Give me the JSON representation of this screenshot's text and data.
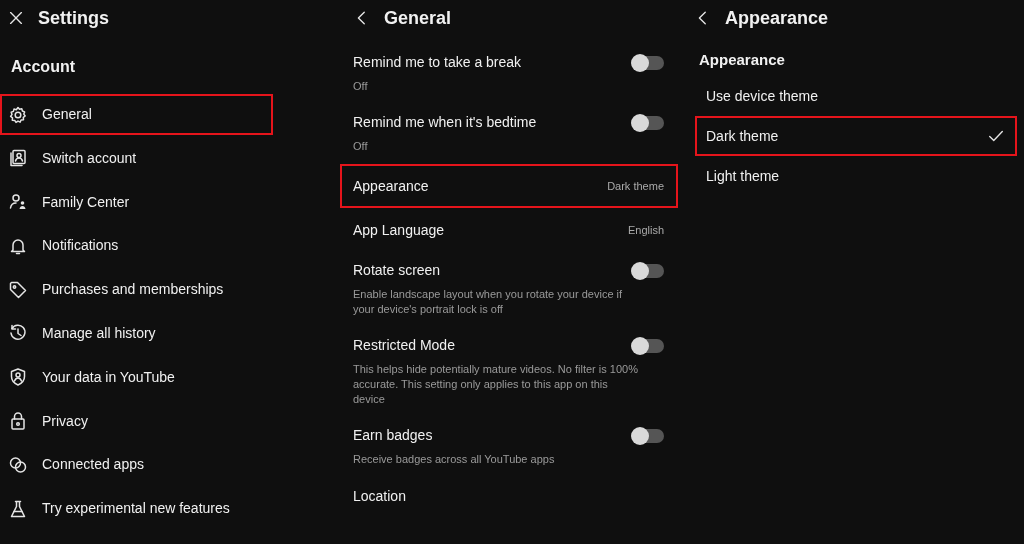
{
  "settings_panel": {
    "title": "Settings",
    "section": "Account",
    "items": [
      {
        "label": "General",
        "highlighted": true
      },
      {
        "label": "Switch account",
        "highlighted": false
      },
      {
        "label": "Family Center",
        "highlighted": false
      },
      {
        "label": "Notifications",
        "highlighted": false
      },
      {
        "label": "Purchases and memberships",
        "highlighted": false
      },
      {
        "label": "Manage all history",
        "highlighted": false
      },
      {
        "label": "Your data in YouTube",
        "highlighted": false
      },
      {
        "label": "Privacy",
        "highlighted": false
      },
      {
        "label": "Connected apps",
        "highlighted": false
      },
      {
        "label": "Try experimental new features",
        "highlighted": false
      }
    ]
  },
  "general_panel": {
    "title": "General",
    "rows": [
      {
        "kind": "toggle",
        "label": "Remind me to take a break",
        "description": "Off",
        "on": false,
        "highlighted": false
      },
      {
        "kind": "toggle",
        "label": "Remind me when it's bedtime",
        "description": "Off",
        "on": false,
        "highlighted": false
      },
      {
        "kind": "value",
        "label": "Appearance",
        "value": "Dark theme",
        "highlighted": true
      },
      {
        "kind": "value",
        "label": "App Language",
        "value": "English",
        "highlighted": false
      },
      {
        "kind": "toggle",
        "label": "Rotate screen",
        "description": "Enable landscape layout when you rotate your device if your device's portrait lock is off",
        "on": false,
        "highlighted": false
      },
      {
        "kind": "toggle",
        "label": "Restricted Mode",
        "description": "This helps hide potentially mature videos. No filter is 100% accurate. This setting only applies to this app on this device",
        "on": false,
        "highlighted": false
      },
      {
        "kind": "toggle",
        "label": "Earn badges",
        "description": "Receive badges across all YouTube apps",
        "on": false,
        "highlighted": false
      },
      {
        "kind": "plain",
        "label": "Location",
        "highlighted": false
      }
    ]
  },
  "appearance_panel": {
    "title": "Appearance",
    "section": "Appearance",
    "options": [
      {
        "label": "Use device theme",
        "selected": false,
        "highlighted": false
      },
      {
        "label": "Dark theme",
        "selected": true,
        "highlighted": true
      },
      {
        "label": "Light theme",
        "selected": false,
        "highlighted": false
      }
    ]
  }
}
